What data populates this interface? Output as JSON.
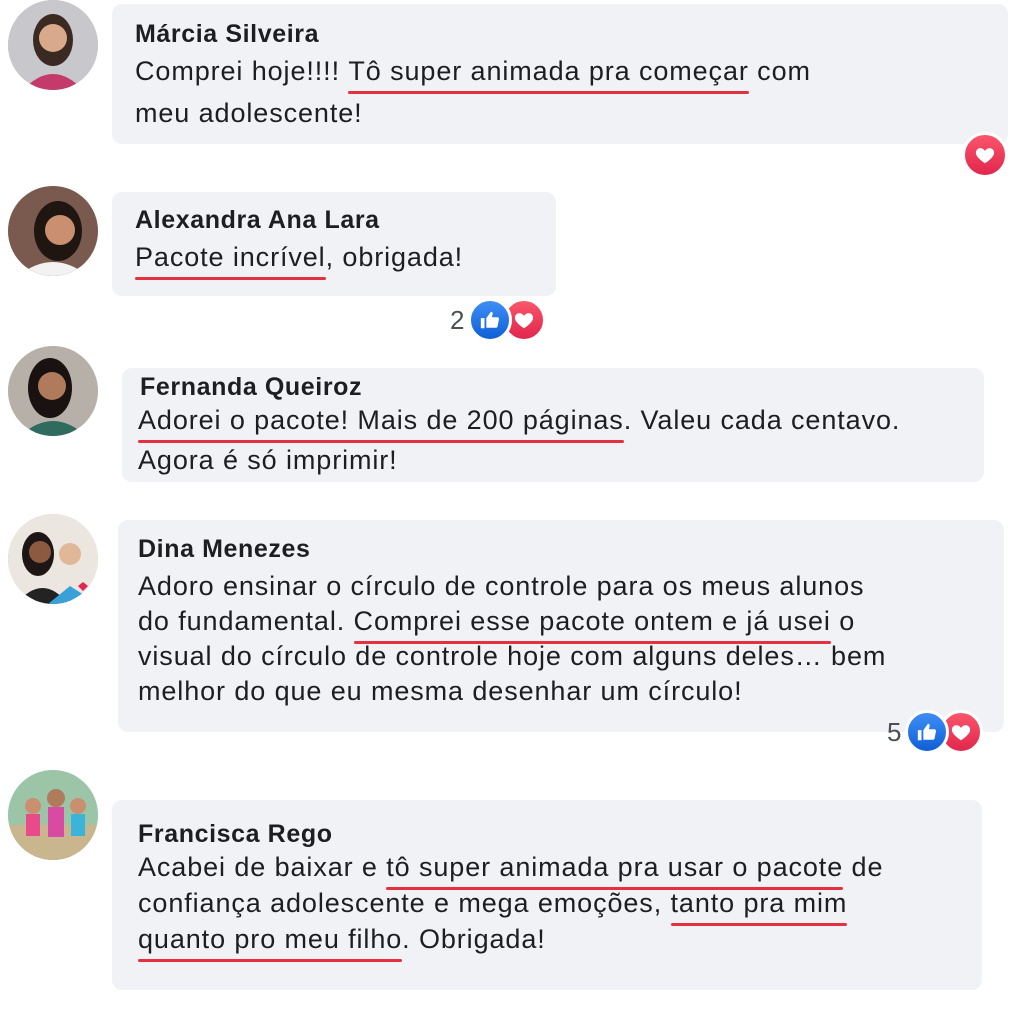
{
  "comments": [
    {
      "name": "Márcia Silveira",
      "lines": [
        [
          "Comprei hoje!!!! ",
          "Tô super animada pra começar",
          " com"
        ],
        [
          "meu adolescente!",
          "",
          ""
        ]
      ]
    },
    {
      "name": "Alexandra Ana Lara",
      "lines": [
        [
          "",
          "Pacote incrível",
          ", obrigada!"
        ]
      ],
      "reaction_count": "2"
    },
    {
      "name": "Fernanda Queiroz",
      "lines": [
        [
          "",
          "Adorei o pacote! Mais de 200 páginas",
          ". Valeu cada centavo."
        ],
        [
          "Agora é só imprimir!",
          "",
          ""
        ]
      ]
    },
    {
      "name": "Dina Menezes",
      "lines": [
        [
          "Adoro ensinar o círculo de controle para os meus alunos",
          "",
          ""
        ],
        [
          "do fundamental. ",
          "Comprei esse pacote ontem e já usei",
          " o"
        ],
        [
          "visual do círculo de controle hoje com alguns deles… bem",
          "",
          ""
        ],
        [
          "melhor do que eu mesma desenhar um círculo!",
          "",
          ""
        ]
      ],
      "reaction_count": "5"
    },
    {
      "name": "Francisca Rego",
      "lines": [
        [
          "Acabei de baixar e ",
          "tô super animada pra usar o pacote",
          " de"
        ],
        [
          "confiança adolescente e mega emoções, ",
          "tanto pra mim",
          ""
        ],
        [
          "",
          "quanto pro meu filho",
          ". Obrigada!"
        ]
      ]
    }
  ],
  "icons": {
    "like": "thumbs-up-icon",
    "love": "heart-icon"
  },
  "colors": {
    "bubble": "#f0f2f5",
    "underline": "#e5313f",
    "like": "#1877f2",
    "love": "#f33e58"
  }
}
